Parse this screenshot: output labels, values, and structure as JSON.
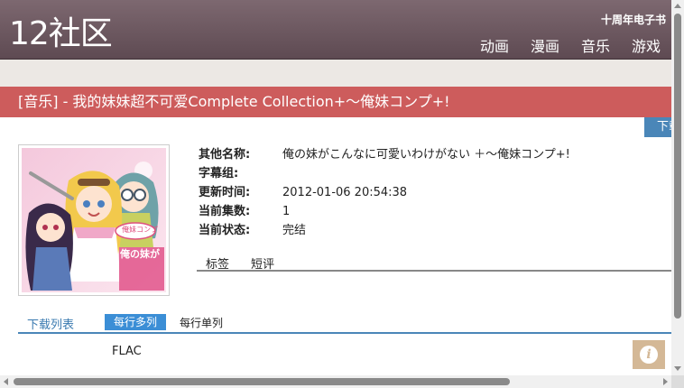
{
  "header": {
    "logo": "12社区",
    "ebook_link": "十周年电子书",
    "nav": [
      "动画",
      "漫画",
      "音乐",
      "游戏"
    ]
  },
  "title": "[音乐] - 我的妹妹超不可爱Complete Collection+～俺妹コンプ+!",
  "download_button": "下载",
  "cover": {
    "art_text": "俺の妹が",
    "badge": "俺妹コンプ"
  },
  "info": [
    {
      "key": "其他名称:",
      "value": "俺の妹がこんなに可愛いわけがない ＋～俺妹コンプ+!"
    },
    {
      "key": "字幕组:",
      "value": ""
    },
    {
      "key": "更新时间:",
      "value": "2012-01-06 20:54:38"
    },
    {
      "key": "当前集数:",
      "value": "1"
    },
    {
      "key": "当前状态:",
      "value": "完结"
    }
  ],
  "tabs": [
    "标签",
    "短评"
  ],
  "download_list": {
    "label": "下载列表",
    "multi": "每行多列",
    "single": "每行单列",
    "format": "FLAC"
  },
  "info_button": "i",
  "colors": {
    "title_bar": "#cd5c5c",
    "header": "#6e5a62",
    "accent": "#3b8ed6",
    "info_button": "#d4b896"
  }
}
